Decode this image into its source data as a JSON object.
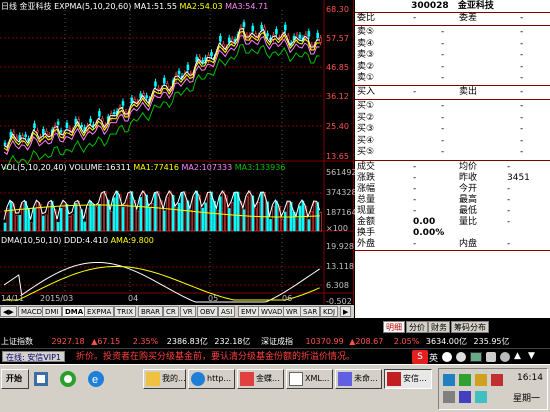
{
  "chart": {
    "header": {
      "period": "日线",
      "stock_name": "金亚科技",
      "indicator": "EXPMA(5,10,20,60)",
      "ma1": "MA1:51.55",
      "ma2": "MA2:54.03",
      "ma3": "MA3:54.71"
    },
    "price_axis": [
      "68.30",
      "57.57",
      "46.85",
      "36.12",
      "25.40",
      "13.65"
    ],
    "volume_header": {
      "label": "VOL(5,10,20,40)",
      "volume": "VOLUME:16311",
      "ma1": "MA1:77416",
      "ma2": "MA2:107333",
      "ma3": "MA3:133936"
    },
    "volume_axis": [
      "561492",
      "374328",
      "187164",
      "×100"
    ],
    "dma_header": {
      "label": "DMA(10,50,10)",
      "ddd": "DDD:4.410",
      "ama": "AMA:9.800"
    },
    "dma_axis": [
      "19.928",
      "13.118",
      "6.308",
      "-0.502"
    ],
    "time_axis": [
      "14/11",
      "2015/03",
      "04",
      "05",
      "06"
    ]
  },
  "indicator_tabs": [
    "MACD",
    "DMI",
    "DMA",
    "EXPMA",
    "TRIX",
    "BRAR",
    "CR",
    "VR",
    "OBV",
    "ASI",
    "EMV",
    "WVAD",
    "WR",
    "SAR",
    "KDJ"
  ],
  "quote_panel": {
    "code": "300028",
    "name": "金亚科技",
    "weibi_label": "委比",
    "weicha_label": "委差",
    "dash": "-",
    "sell_labels": [
      "卖⑤",
      "卖④",
      "卖③",
      "卖②",
      "卖①"
    ],
    "buy_labels": [
      "买①",
      "买②",
      "买③",
      "买④",
      "买⑤"
    ],
    "buy_in_label": "买入",
    "sell_out_label": "卖出",
    "stats": [
      {
        "l1": "成交",
        "v1": "-",
        "l2": "均价",
        "v2": "-"
      },
      {
        "l1": "涨跌",
        "v1": "-",
        "l2": "昨收",
        "v2": "3451"
      },
      {
        "l1": "涨幅",
        "v1": "-",
        "l2": "今开",
        "v2": "-"
      },
      {
        "l1": "总量",
        "v1": "-",
        "l2": "最高",
        "v2": "-"
      },
      {
        "l1": "现量",
        "v1": "-",
        "l2": "最低",
        "v2": "-"
      },
      {
        "l1": "金额",
        "v1": "0.00",
        "l2": "量比",
        "v2": "-"
      },
      {
        "l1": "换手",
        "v1": "0.00%",
        "l2": "",
        "v2": ""
      },
      {
        "l1": "外盘",
        "v1": "-",
        "l2": "内盘",
        "v2": "-"
      }
    ]
  },
  "right_tabs": [
    "明细",
    "分价",
    "财务",
    "筹码分布"
  ],
  "status_bar": {
    "sh_label": "上证指数",
    "sh_value": "2927.18",
    "sh_change": "▲67.15",
    "sh_pct": "2.35%",
    "sh_amount": "2386.83亿",
    "sz_amount_prefix": "232.18亿",
    "sz_value_label": "深证成指",
    "sz_value": "10370.99",
    "sz_change": "▲208.67",
    "sz_pct": "2.05%",
    "sz_amount": "3634.00亿",
    "sz_extra": "235.95亿"
  },
  "notice": {
    "left_label": "在线: 安信VIP1",
    "message": "折价。投资者在购买分级基金前，要认清分级基金份额的折溢价情况。"
  },
  "taskbar": {
    "start_label": "开始",
    "buttons": [
      "我的...",
      "http...",
      "金蝶...",
      "XML...",
      "未命...",
      "安信..."
    ],
    "time": "16:14",
    "weekday": "星期一"
  }
}
